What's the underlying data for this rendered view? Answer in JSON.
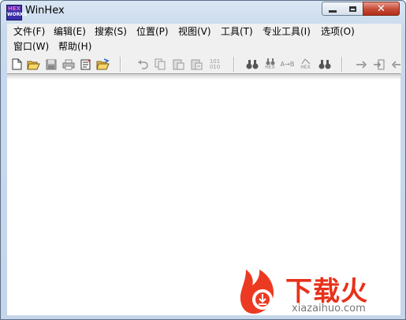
{
  "window": {
    "title": "WinHex",
    "icon_text_top": "HEX",
    "icon_text_bottom": "WORKS"
  },
  "menu": {
    "items": [
      "文件(F)",
      "编辑(E)",
      "搜索(S)",
      "位置(P)",
      "视图(V)",
      "工具(T)",
      "专业工具(I)",
      "选项(O)",
      "窗口(W)",
      "帮助(H)"
    ]
  },
  "toolbar": {
    "icons": [
      "new-file-icon",
      "open-folder-icon",
      "save-icon",
      "print-icon",
      "properties-icon",
      "open-dir-icon",
      "undo-icon",
      "copy-icon",
      "paste-icon",
      "paste-special-icon",
      "binary-icon",
      "find-text-icon",
      "find-hex-icon",
      "replace-text-icon",
      "replace-hex-icon",
      "find-again-icon",
      "goto-offset-icon",
      "goto-position-icon",
      "back-icon"
    ],
    "binary_glyph": "101\n010",
    "hex_label": "HEX",
    "ab_label": "A→B"
  },
  "watermark": {
    "text": "下载火",
    "url": "xiazaihuo.com",
    "color": "#e8311a"
  }
}
